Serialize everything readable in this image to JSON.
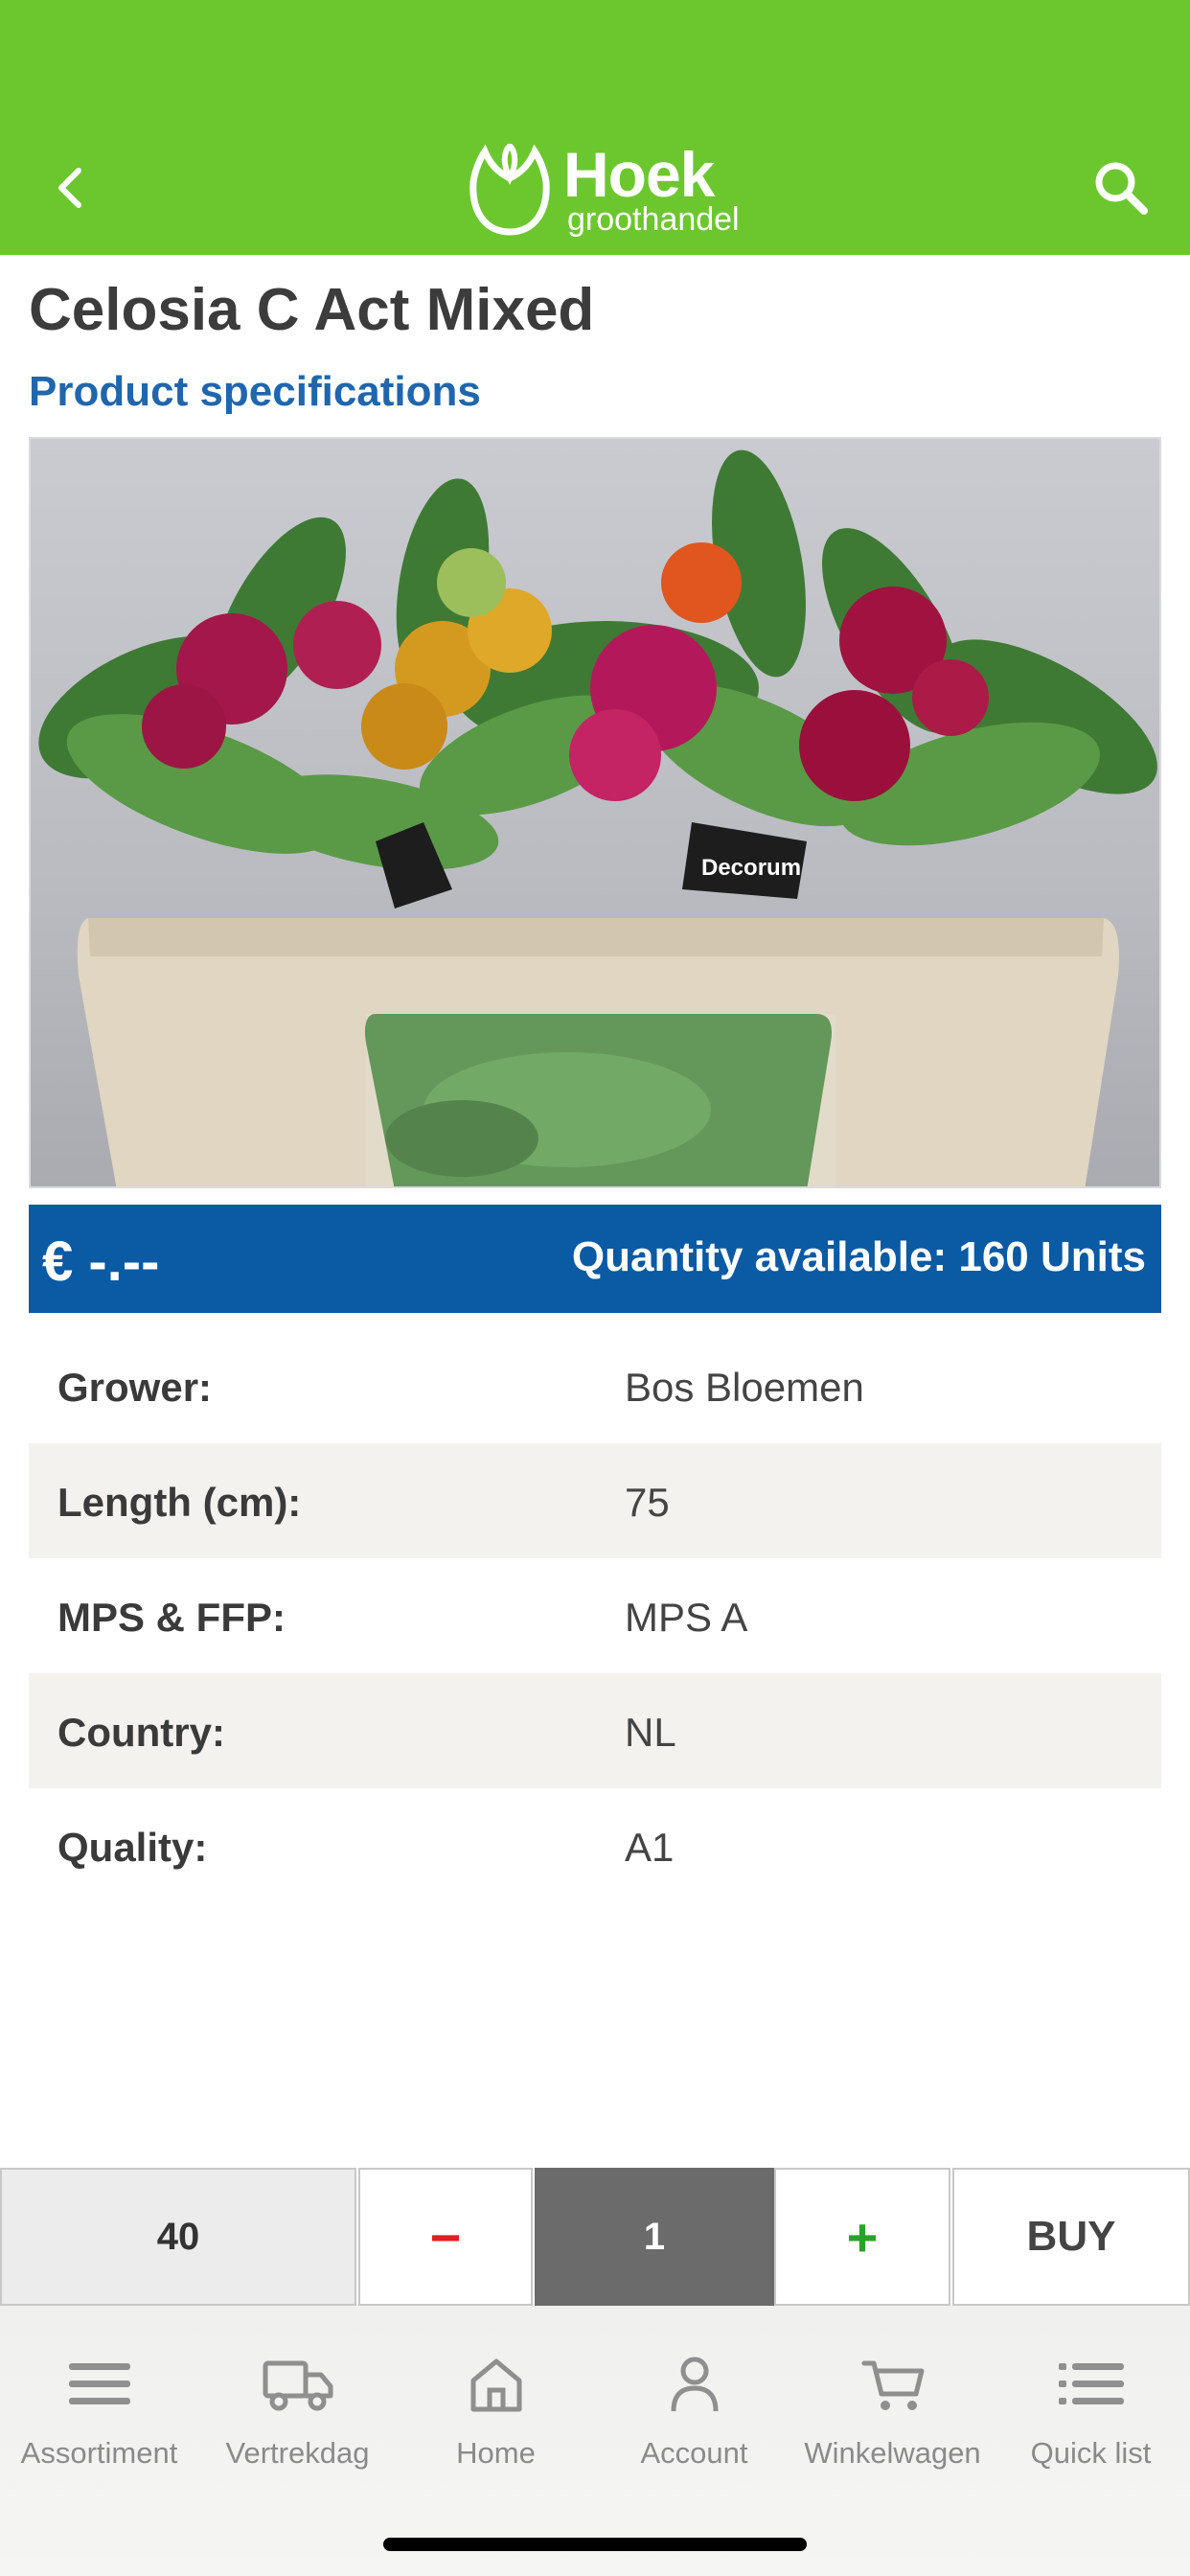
{
  "header": {
    "brand_name": "Hoek",
    "brand_sub": "groothandel",
    "background_color": "#6cc72e",
    "back_icon": "chevron-left-icon",
    "search_icon": "search-icon"
  },
  "product": {
    "title": "Celosia C Act Mixed",
    "spec_link": "Product specifications",
    "image_label": "Decorum"
  },
  "price_bar": {
    "price": "€ -.--",
    "quantity_available": "Quantity available: 160 Units",
    "background_color": "#0a5aa4"
  },
  "specs": [
    {
      "key": "Grower:",
      "value": "Bos Bloemen"
    },
    {
      "key": "Length (cm):",
      "value": "75"
    },
    {
      "key": "MPS & FFP:",
      "value": "MPS A"
    },
    {
      "key": "Country:",
      "value": "NL"
    },
    {
      "key": "Quality:",
      "value": "A1"
    }
  ],
  "buy_bar": {
    "step_size": "40",
    "minus": "−",
    "quantity": "1",
    "plus": "+",
    "buy": "BUY"
  },
  "tabs": [
    {
      "label": "Assortiment",
      "icon": "menu-icon"
    },
    {
      "label": "Vertrekdag",
      "icon": "truck-icon"
    },
    {
      "label": "Home",
      "icon": "home-icon"
    },
    {
      "label": "Account",
      "icon": "user-icon"
    },
    {
      "label": "Winkelwagen",
      "icon": "cart-icon"
    },
    {
      "label": "Quick list",
      "icon": "list-icon"
    }
  ]
}
